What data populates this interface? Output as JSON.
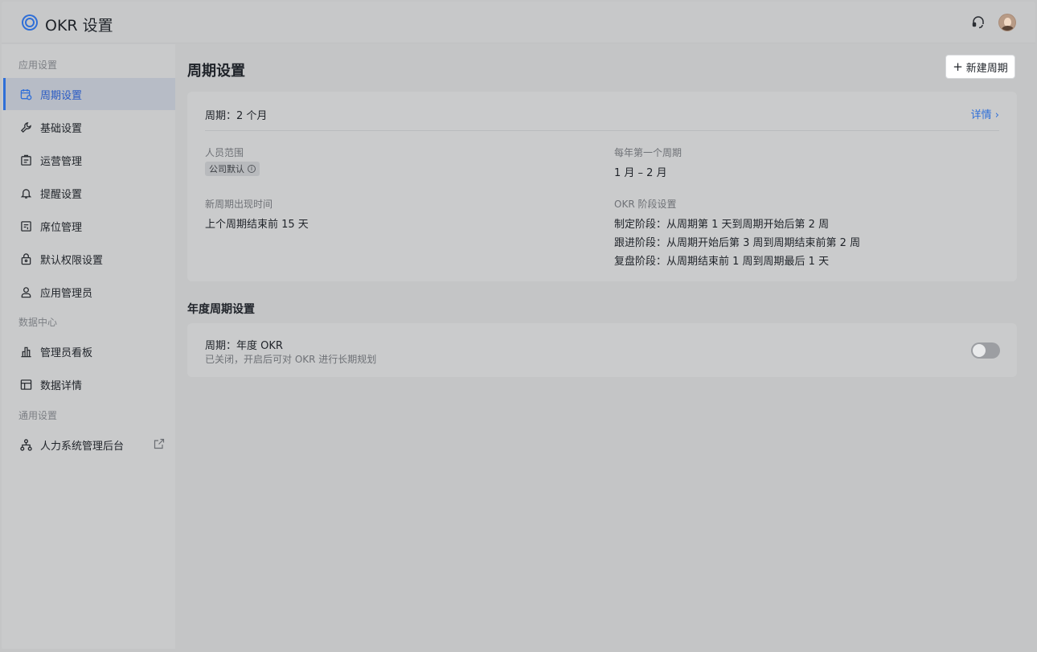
{
  "header": {
    "app_title": "OKR 设置"
  },
  "sidebar": {
    "sections": [
      {
        "label": "应用设置"
      },
      {
        "label": "数据中心"
      },
      {
        "label": "通用设置"
      }
    ],
    "items": [
      {
        "label": "周期设置",
        "icon": "calendar-settings-icon",
        "active": true
      },
      {
        "label": "基础设置",
        "icon": "wrench-icon"
      },
      {
        "label": "运营管理",
        "icon": "operations-icon"
      },
      {
        "label": "提醒设置",
        "icon": "bell-icon"
      },
      {
        "label": "席位管理",
        "icon": "seat-icon"
      },
      {
        "label": "默认权限设置",
        "icon": "lock-icon"
      },
      {
        "label": "应用管理员",
        "icon": "user-icon"
      },
      {
        "label": "管理员看板",
        "icon": "bar-chart-icon"
      },
      {
        "label": "数据详情",
        "icon": "table-icon"
      },
      {
        "label": "人力系统管理后台",
        "icon": "org-chart-icon",
        "external": true
      }
    ]
  },
  "main": {
    "title": "周期设置",
    "new_button": "新建周期",
    "cycle_card": {
      "heading": "周期：2 个月",
      "detail_link": "详情",
      "scope_label": "人员范围",
      "scope_tag": "公司默认",
      "first_cycle_label": "每年第一个周期",
      "first_cycle_value": "1 月 – 2 月",
      "new_cycle_label": "新周期出现时间",
      "new_cycle_value": "上个周期结束前 15 天",
      "stage_label": "OKR 阶段设置",
      "stages": [
        "制定阶段：从周期第 1 天到周期开始后第 2 周",
        "跟进阶段：从周期开始后第 3 周到周期结束前第 2 周",
        "复盘阶段：从周期结束前 1 周到周期最后 1 天"
      ]
    },
    "annual_section_title": "年度周期设置",
    "annual_card": {
      "title": "周期：年度 OKR",
      "description": "已关闭，开启后可对 OKR 进行长期规划",
      "enabled": false
    }
  },
  "colors": {
    "accent": "#2f6fd8",
    "background": "#c4c5c6"
  }
}
